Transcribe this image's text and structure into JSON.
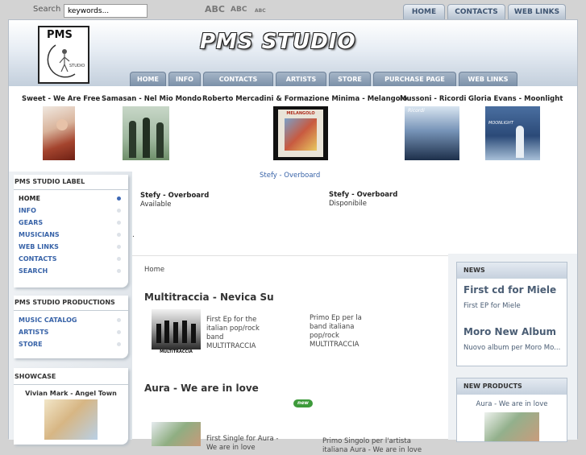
{
  "topbar": {
    "search_label": "Search",
    "search_placeholder": "keywords...",
    "font_sizes": [
      "ABC",
      "ABC",
      "ABC"
    ],
    "tabs": [
      "HOME",
      "CONTACTS",
      "WEB LINKS"
    ]
  },
  "header": {
    "logo_text": "PMS",
    "logo_sub": "STUDIO",
    "title": "PMS STUDIO",
    "nav": [
      "HOME",
      "INFO",
      "CONTACTS",
      "ARTISTS",
      "STORE",
      "PURCHASE PAGE",
      "WEB LINKS"
    ]
  },
  "featured": [
    {
      "title": "Sweet - We Are Free"
    },
    {
      "title": "Samasan - Nel Mio Mondo"
    },
    {
      "title": "Roberto Mercadini & Formazione Minima - Melangolo",
      "cover_text": "MELANGOLO"
    },
    {
      "title": "Mussoni - Ricordi",
      "cover_text": "Ricordi"
    },
    {
      "title": "Gloria Evans - Moonlight",
      "cover_text": "MOONLIGHT"
    }
  ],
  "sidebar": {
    "label_heading": "PMS STUDIO LABEL",
    "label_items": [
      "HOME",
      "INFO",
      "GEARS",
      "MUSICIANS",
      "WEB LINKS",
      "CONTACTS",
      "SEARCH"
    ],
    "productions_heading": "PMS STUDIO PRODUCTIONS",
    "productions_items": [
      "MUSIC CATALOG",
      "ARTISTS",
      "STORE"
    ],
    "showcase_heading": "SHOWCASE",
    "showcase_title": "Vivian Mark - Angel Town"
  },
  "center_top": {
    "link": "Stefy - Overboard",
    "col1_title": "Stefy - Overboard",
    "col1_text": "Available",
    "col2_title": "Stefy - Overboard",
    "col2_text": "Disponibile",
    "dot": "."
  },
  "main": {
    "breadcrumb": "Home",
    "products": [
      {
        "title": "Multitraccia - Nevica Su",
        "desc_en": "First Ep for the italian pop/rock band MULTITRACCIA",
        "desc_it": "Primo Ep per la band italiana pop/rock MULTITRACCIA",
        "cover_text": "MULTITRACCIA"
      },
      {
        "title": "Aura - We are in love",
        "desc_en": "First Single for Aura - We are in love",
        "desc_it": "Primo Singolo per l'artista italiana Aura - We are in love",
        "badge": "new"
      }
    ]
  },
  "right": {
    "news_heading": "NEWS",
    "news": [
      {
        "title": "First cd for Miele",
        "desc": "First EP for Miele"
      },
      {
        "title": "Moro New Album",
        "desc": "Nuovo album per Moro Mo..."
      }
    ],
    "new_products_heading": "NEW PRODUCTS",
    "new_product_title": "Aura - We are in love"
  }
}
